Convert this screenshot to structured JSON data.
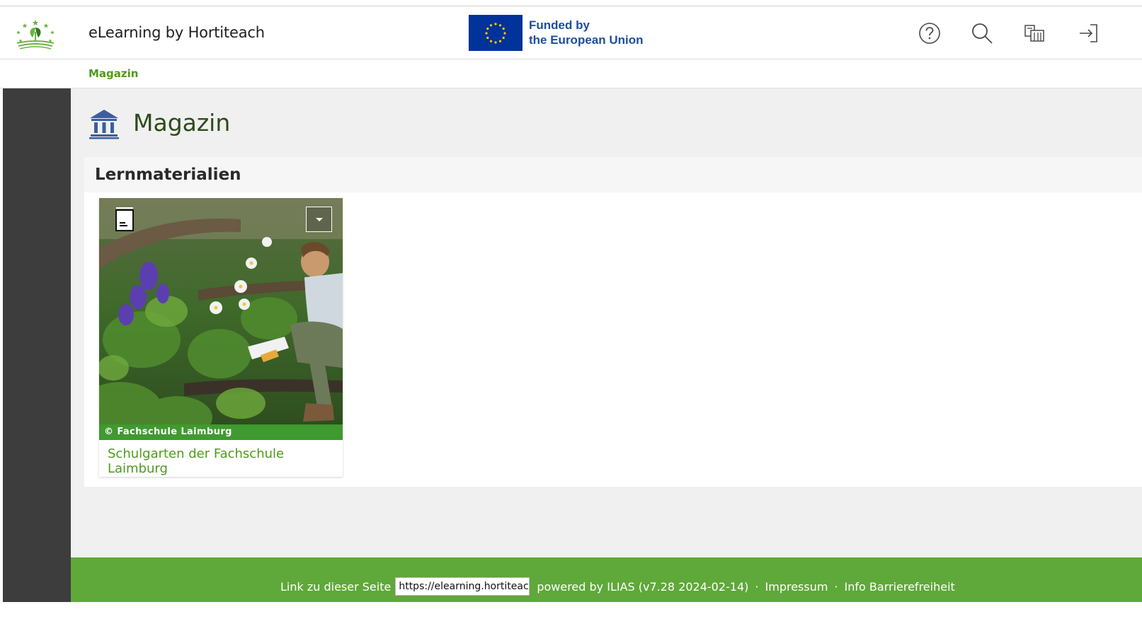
{
  "header": {
    "site_title": "eLearning by Hortiteach",
    "eu_line1": "Funded by",
    "eu_line2": "the European Union",
    "buttons": [
      {
        "name": "help-icon"
      },
      {
        "name": "search-icon"
      },
      {
        "name": "language-icon"
      },
      {
        "name": "login-icon"
      }
    ]
  },
  "breadcrumb": {
    "item": "Magazin"
  },
  "main": {
    "title": "Magazin",
    "section_title": "Lernmaterialien",
    "card": {
      "caption": "© Fachschule Laimburg",
      "title": "Schulgarten der Fachschule Laimburg"
    }
  },
  "footer": {
    "link_label": "Link zu dieser Seite",
    "permalink_value": "https://elearning.hortiteach",
    "powered": "powered by ILIAS (v7.28 2024-02-14)",
    "sep1": "·",
    "impressum": "Impressum",
    "sep2": "·",
    "accessibility": "Info Barrierefreiheit"
  },
  "colors": {
    "accent_green": "#4e9a1b",
    "footer_green": "#5fa83a",
    "eu_blue": "#003399",
    "sidebar_dark": "#3d3d3d"
  }
}
